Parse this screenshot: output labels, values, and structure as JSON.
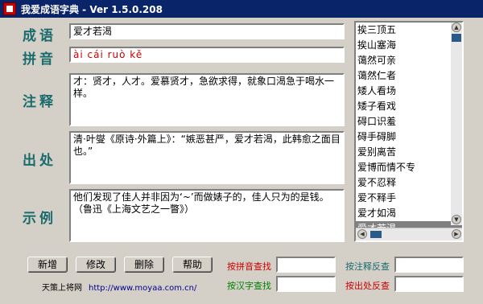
{
  "window": {
    "title": "我爱成语字典 - Ver 1.5.0.208"
  },
  "labels": {
    "idiom": "成语",
    "pinyin": "拼音",
    "explanation": "注释",
    "source": "出处",
    "example": "示例"
  },
  "fields": {
    "idiom": "爱才若渴",
    "pinyin": "ài  cái  ruò  kě",
    "explanation": "才：贤才，人才。爱慕贤才，急欲求得，就象口渴急于喝水一样。",
    "source": "清·叶燮《原诗·外篇上》：“嫉恶甚严，爱才若渴，此韩愈之面目也。”",
    "example": "他们发现了佳人并非因为‘~’而做婊子的，佳人只为的是钱。（鲁迅《上海文艺之一瞥》）"
  },
  "list": {
    "items": [
      "挨三顶五",
      "挨山塞海",
      "蔼然可亲",
      "蔼然仁者",
      "矮人看场",
      "矮子看戏",
      "碍口识羞",
      "碍手碍脚",
      "爱别离苦",
      "爱博而情不专",
      "爱不忍释",
      "爱不释手",
      "爱才如渴",
      "爱才若渴"
    ],
    "selected_index": 13
  },
  "buttons": {
    "add": "新增",
    "edit": "修改",
    "delete": "删除",
    "help": "帮助"
  },
  "search": {
    "by_pinyin": "按拼音查找",
    "by_explanation": "按注释反查",
    "by_char": "按汉字查找",
    "by_source": "按出处反查"
  },
  "footer": {
    "site_name": "天策上将网",
    "url": "http://www.moyaa.com.cn/"
  },
  "colors": {
    "label": "#1a6b6b",
    "pinyin": "#c00",
    "search_red": "#cc0000",
    "search_green": "#008000",
    "search_teal": "#1a6b6b"
  }
}
